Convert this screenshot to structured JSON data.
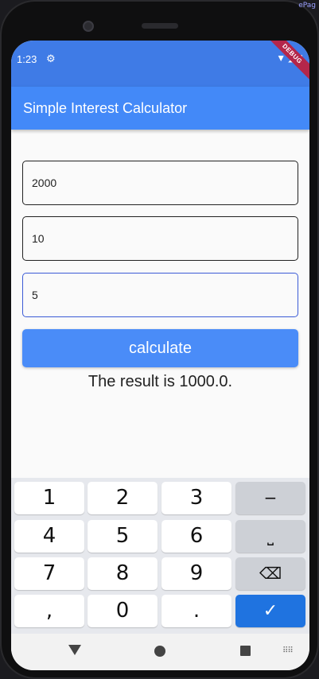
{
  "status_bar": {
    "time": "1:23",
    "settings_icon": "gear-icon",
    "debug_label": "DEBUG",
    "icons": [
      "wifi-icon",
      "signal-icon",
      "battery-icon"
    ]
  },
  "app_bar": {
    "title": "Simple Interest Calculator"
  },
  "fields": {
    "principal": "2000",
    "time": "10",
    "rate": "5"
  },
  "button": {
    "label": "calculate"
  },
  "result": {
    "text": "The result is 1000.0."
  },
  "keyboard": {
    "keys": {
      "k1": "1",
      "k2": "2",
      "k3": "3",
      "minus": "−",
      "k4": "4",
      "k5": "5",
      "k6": "6",
      "space": "⎵",
      "k7": "7",
      "k8": "8",
      "k9": "9",
      "backspace": "⌫",
      "comma": ",",
      "k0": "0",
      "dot": ".",
      "done": "✓"
    }
  },
  "corner_text": "ePag",
  "colors": {
    "status_bar": "#3f7be6",
    "app_bar": "#4389f8",
    "button": "#4a8cf8",
    "done_key": "#1f73e0",
    "focus_border": "#3b5bd6"
  }
}
